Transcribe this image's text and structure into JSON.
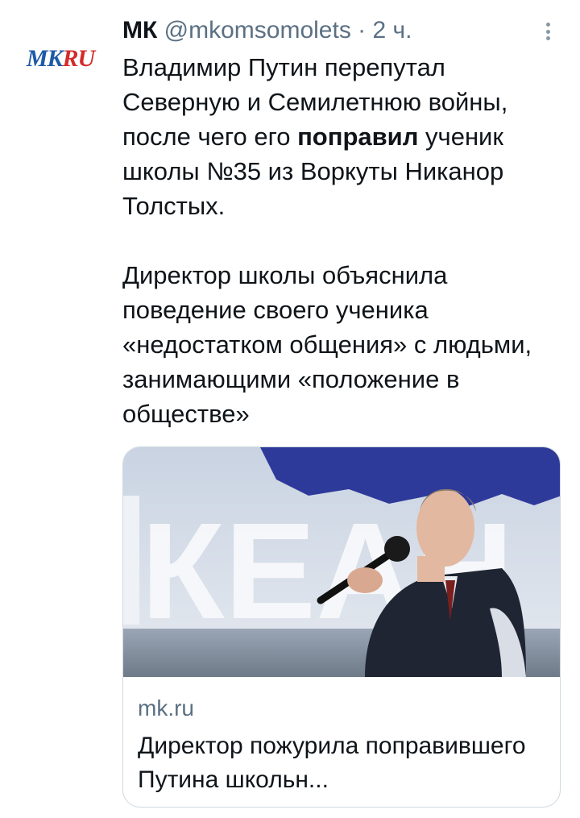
{
  "tweet": {
    "author_name": "МК",
    "handle": "@mkomsomolets",
    "separator": "·",
    "time": "2 ч.",
    "avatar_logo": "MKRU",
    "avatar_logo_prefix": "MK",
    "avatar_logo_suffix": "RU",
    "text": {
      "p1_before": "Владимир Путин перепутал Северную и Семилетнюю войны, после чего его ",
      "p1_bold": "поправил",
      "p1_after": " ученик школы №35 из Воркуты Никанор Толстых.",
      "p2": "Директор школы объяснила поведение своего ученика «недостатком общения» с людьми, занимающими «положение в обществе»"
    },
    "more_icon": "more-vertical-icon"
  },
  "card": {
    "image_backdrop_letters": "КЕАН",
    "domain": "mk.ru",
    "title": "Директор пожурила поправившего Путина школьн..."
  },
  "colors": {
    "text": "#0f1419",
    "secondary": "#5b7083",
    "border": "#cfd9de",
    "logo_blue": "#1d5aa8",
    "logo_red": "#d42a2a"
  }
}
